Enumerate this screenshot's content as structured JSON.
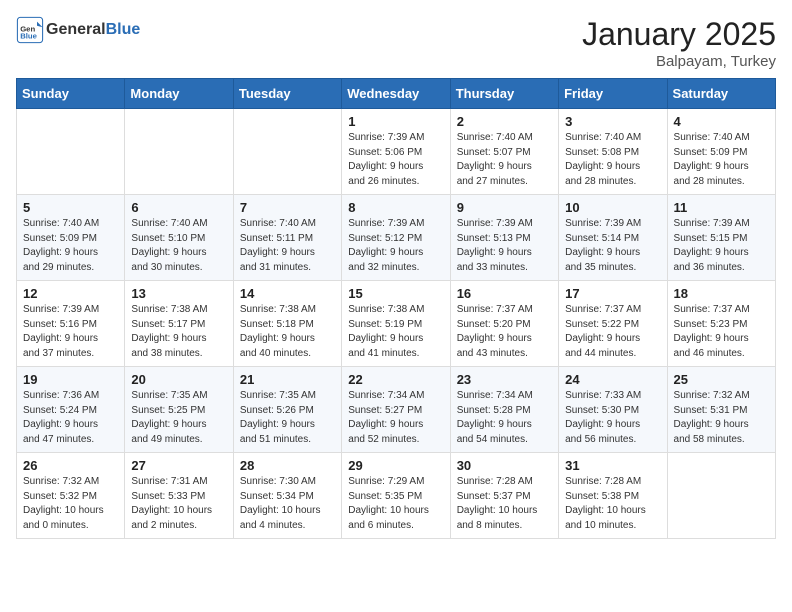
{
  "header": {
    "logo_general": "General",
    "logo_blue": "Blue",
    "month": "January 2025",
    "location": "Balpayam, Turkey"
  },
  "weekdays": [
    "Sunday",
    "Monday",
    "Tuesday",
    "Wednesday",
    "Thursday",
    "Friday",
    "Saturday"
  ],
  "weeks": [
    [
      {
        "day": "",
        "info": ""
      },
      {
        "day": "",
        "info": ""
      },
      {
        "day": "",
        "info": ""
      },
      {
        "day": "1",
        "info": "Sunrise: 7:39 AM\nSunset: 5:06 PM\nDaylight: 9 hours\nand 26 minutes."
      },
      {
        "day": "2",
        "info": "Sunrise: 7:40 AM\nSunset: 5:07 PM\nDaylight: 9 hours\nand 27 minutes."
      },
      {
        "day": "3",
        "info": "Sunrise: 7:40 AM\nSunset: 5:08 PM\nDaylight: 9 hours\nand 28 minutes."
      },
      {
        "day": "4",
        "info": "Sunrise: 7:40 AM\nSunset: 5:09 PM\nDaylight: 9 hours\nand 28 minutes."
      }
    ],
    [
      {
        "day": "5",
        "info": "Sunrise: 7:40 AM\nSunset: 5:09 PM\nDaylight: 9 hours\nand 29 minutes."
      },
      {
        "day": "6",
        "info": "Sunrise: 7:40 AM\nSunset: 5:10 PM\nDaylight: 9 hours\nand 30 minutes."
      },
      {
        "day": "7",
        "info": "Sunrise: 7:40 AM\nSunset: 5:11 PM\nDaylight: 9 hours\nand 31 minutes."
      },
      {
        "day": "8",
        "info": "Sunrise: 7:39 AM\nSunset: 5:12 PM\nDaylight: 9 hours\nand 32 minutes."
      },
      {
        "day": "9",
        "info": "Sunrise: 7:39 AM\nSunset: 5:13 PM\nDaylight: 9 hours\nand 33 minutes."
      },
      {
        "day": "10",
        "info": "Sunrise: 7:39 AM\nSunset: 5:14 PM\nDaylight: 9 hours\nand 35 minutes."
      },
      {
        "day": "11",
        "info": "Sunrise: 7:39 AM\nSunset: 5:15 PM\nDaylight: 9 hours\nand 36 minutes."
      }
    ],
    [
      {
        "day": "12",
        "info": "Sunrise: 7:39 AM\nSunset: 5:16 PM\nDaylight: 9 hours\nand 37 minutes."
      },
      {
        "day": "13",
        "info": "Sunrise: 7:38 AM\nSunset: 5:17 PM\nDaylight: 9 hours\nand 38 minutes."
      },
      {
        "day": "14",
        "info": "Sunrise: 7:38 AM\nSunset: 5:18 PM\nDaylight: 9 hours\nand 40 minutes."
      },
      {
        "day": "15",
        "info": "Sunrise: 7:38 AM\nSunset: 5:19 PM\nDaylight: 9 hours\nand 41 minutes."
      },
      {
        "day": "16",
        "info": "Sunrise: 7:37 AM\nSunset: 5:20 PM\nDaylight: 9 hours\nand 43 minutes."
      },
      {
        "day": "17",
        "info": "Sunrise: 7:37 AM\nSunset: 5:22 PM\nDaylight: 9 hours\nand 44 minutes."
      },
      {
        "day": "18",
        "info": "Sunrise: 7:37 AM\nSunset: 5:23 PM\nDaylight: 9 hours\nand 46 minutes."
      }
    ],
    [
      {
        "day": "19",
        "info": "Sunrise: 7:36 AM\nSunset: 5:24 PM\nDaylight: 9 hours\nand 47 minutes."
      },
      {
        "day": "20",
        "info": "Sunrise: 7:35 AM\nSunset: 5:25 PM\nDaylight: 9 hours\nand 49 minutes."
      },
      {
        "day": "21",
        "info": "Sunrise: 7:35 AM\nSunset: 5:26 PM\nDaylight: 9 hours\nand 51 minutes."
      },
      {
        "day": "22",
        "info": "Sunrise: 7:34 AM\nSunset: 5:27 PM\nDaylight: 9 hours\nand 52 minutes."
      },
      {
        "day": "23",
        "info": "Sunrise: 7:34 AM\nSunset: 5:28 PM\nDaylight: 9 hours\nand 54 minutes."
      },
      {
        "day": "24",
        "info": "Sunrise: 7:33 AM\nSunset: 5:30 PM\nDaylight: 9 hours\nand 56 minutes."
      },
      {
        "day": "25",
        "info": "Sunrise: 7:32 AM\nSunset: 5:31 PM\nDaylight: 9 hours\nand 58 minutes."
      }
    ],
    [
      {
        "day": "26",
        "info": "Sunrise: 7:32 AM\nSunset: 5:32 PM\nDaylight: 10 hours\nand 0 minutes."
      },
      {
        "day": "27",
        "info": "Sunrise: 7:31 AM\nSunset: 5:33 PM\nDaylight: 10 hours\nand 2 minutes."
      },
      {
        "day": "28",
        "info": "Sunrise: 7:30 AM\nSunset: 5:34 PM\nDaylight: 10 hours\nand 4 minutes."
      },
      {
        "day": "29",
        "info": "Sunrise: 7:29 AM\nSunset: 5:35 PM\nDaylight: 10 hours\nand 6 minutes."
      },
      {
        "day": "30",
        "info": "Sunrise: 7:28 AM\nSunset: 5:37 PM\nDaylight: 10 hours\nand 8 minutes."
      },
      {
        "day": "31",
        "info": "Sunrise: 7:28 AM\nSunset: 5:38 PM\nDaylight: 10 hours\nand 10 minutes."
      },
      {
        "day": "",
        "info": ""
      }
    ]
  ]
}
